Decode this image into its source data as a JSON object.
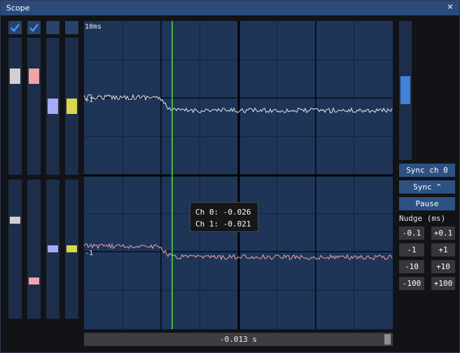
{
  "window": {
    "title": "Scope",
    "close_glyph": "×"
  },
  "channels": [
    {
      "enabled": true,
      "color": "#d0d0d0",
      "offset_level": 0.82,
      "scale_level": 0.23
    },
    {
      "enabled": true,
      "color": "#f2a2a8",
      "offset_level": 0.82,
      "scale_level": 0.27
    },
    {
      "enabled": false,
      "color": "#a9a9f7",
      "offset_level": 0.6,
      "scale_level": 0.51
    },
    {
      "enabled": false,
      "color": "#d8d84a",
      "offset_level": 0.6,
      "scale_level": 0.51
    }
  ],
  "plot": {
    "time_label": "10ms",
    "top_ref_label": "+1",
    "bottom_ref_label": "-1",
    "cursor_position": 0.285,
    "colors": {
      "background": "#1e3558",
      "grid": "#122440",
      "axis": "#000000",
      "cursor": "#52e23c"
    }
  },
  "tooltip": {
    "ch0": "Ch 0: -0.026",
    "ch1": "Ch 1: -0.021"
  },
  "timebar": {
    "value": "-0.013 s"
  },
  "trigger_slider_level": 0.5,
  "controls": {
    "sync_ch": "Sync ch 0",
    "sync_edge": "Sync ^",
    "pause": "Pause",
    "nudge_label": "Nudge (ms)",
    "nudge": [
      "-0.1",
      "+0.1",
      "-1",
      "+1",
      "-10",
      "+10",
      "-100",
      "+100"
    ]
  }
}
